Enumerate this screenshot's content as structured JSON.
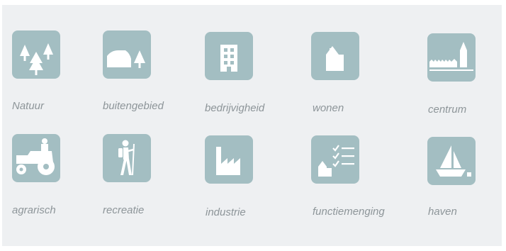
{
  "categories": [
    {
      "label": "Natuur",
      "icon": "trees-icon"
    },
    {
      "label": "buitengebied",
      "icon": "barn-tree-icon"
    },
    {
      "label": "bedrijvigheid",
      "icon": "office-building-icon"
    },
    {
      "label": "wonen",
      "icon": "house-icon"
    },
    {
      "label": "centrum",
      "icon": "village-church-icon"
    },
    {
      "label": "agrarisch",
      "icon": "tractor-icon"
    },
    {
      "label": "recreatie",
      "icon": "hiker-icon"
    },
    {
      "label": "industrie",
      "icon": "factory-icon"
    },
    {
      "label": "functiemenging",
      "icon": "mixed-use-checklist-icon"
    },
    {
      "label": "haven",
      "icon": "sailboat-icon"
    }
  ],
  "colors": {
    "tile": "#a3bec2",
    "label": "#8d9599",
    "background": "#eef0f2"
  }
}
